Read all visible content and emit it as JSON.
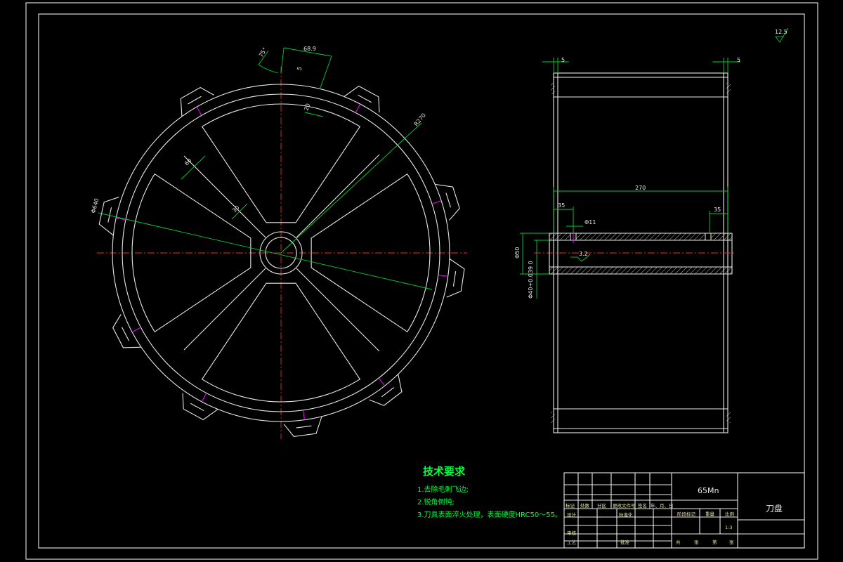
{
  "dimensions": {
    "chamfer_angle": "75°",
    "blade_width": "68.9",
    "blade_small_1": "5",
    "blade_small_2": "20",
    "outer_radius": "R270",
    "spoke_width": "60",
    "spoke_inner": "30",
    "diameter_d640": "Φ640",
    "side_margin_left": "5",
    "side_margin_right": "5",
    "total_width": "270",
    "left_step": "35",
    "right_step": "35",
    "hole_dia": "Φ11",
    "shaft_d50": "Φ50",
    "shaft_d40_tol": "Φ40+0.039 0",
    "surface_finish": "3.2",
    "roughness_symbol": "12.5"
  },
  "technical_requirements": {
    "title": "技术要求",
    "items": [
      "1.去除毛刺飞边;",
      "2.锐角倒钝;",
      "3.刀具表面淬火处理，表面硬度HRC50～55。"
    ]
  },
  "title_block": {
    "material": "65Mn",
    "part_name": "刀盘",
    "header_labels": [
      "标记",
      "处数",
      "分区",
      "更改文件号",
      "签名",
      "年、月、日"
    ],
    "row_labels": [
      "设计",
      "标准化",
      "审核",
      "工艺",
      "批准"
    ],
    "stage_label": "阶段标记",
    "weight_label": "重量",
    "ratio_label": "比例",
    "scale": "1:3",
    "sheet_labels": [
      "共",
      "张",
      "第",
      "张"
    ]
  },
  "colors": {
    "outline": "#e8e8e8",
    "dimension": "#00cc33",
    "centerline": "#ff2020",
    "highlight": "#ff00ff",
    "annotation": "#00ff40"
  }
}
